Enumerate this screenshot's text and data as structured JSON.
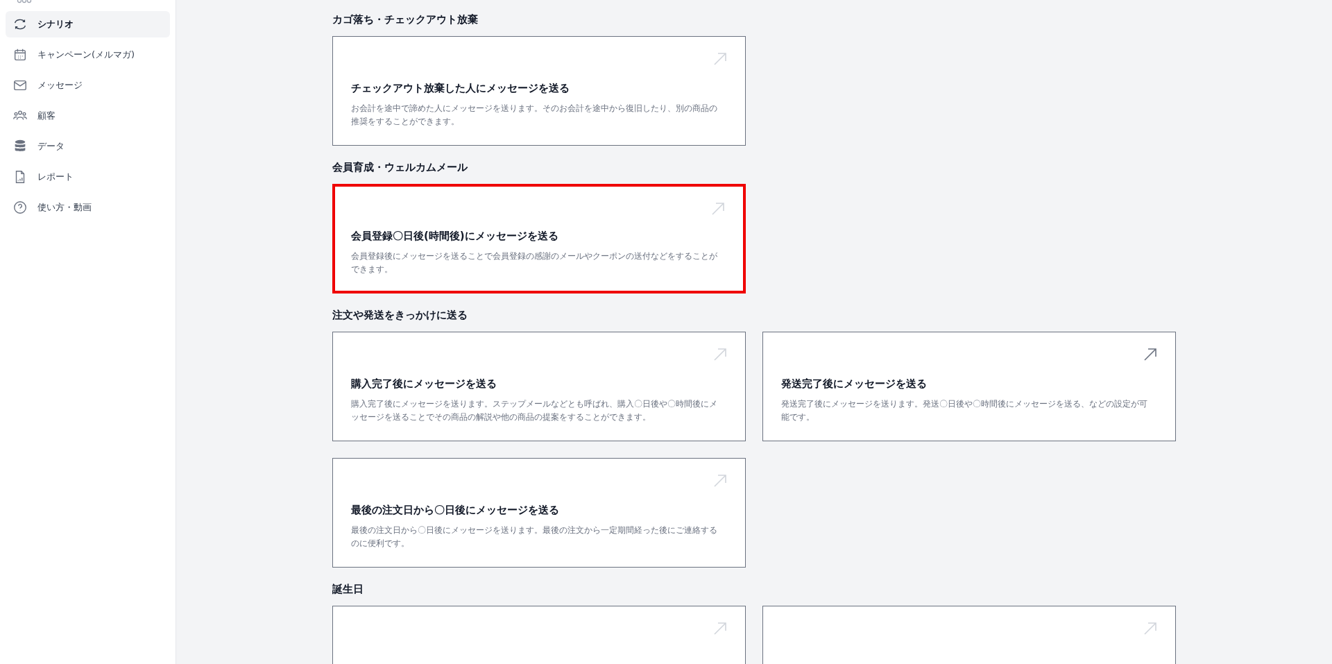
{
  "sidebar": {
    "items": [
      {
        "kind": "refresh",
        "label": "シナリオ",
        "selected": true
      },
      {
        "kind": "calendar",
        "label": "キャンペーン(メルマガ)",
        "selected": false
      },
      {
        "kind": "mail",
        "label": "メッセージ",
        "selected": false
      },
      {
        "kind": "users",
        "label": "顧客",
        "selected": false
      },
      {
        "kind": "database",
        "label": "データ",
        "selected": false
      },
      {
        "kind": "report",
        "label": "レポート",
        "selected": false
      },
      {
        "kind": "help",
        "label": "使い方・動画",
        "selected": false
      }
    ]
  },
  "sections": [
    {
      "heading": "カゴ落ち・チェックアウト放棄",
      "cards": [
        {
          "title": "チェックアウト放棄した人にメッセージを送る",
          "description": "お会計を途中で諦めた人にメッセージを送ります。そのお会計を途中から復旧したり、別の商品の推奨をすることができます。",
          "highlighted": false,
          "hovered": false
        }
      ]
    },
    {
      "heading": "会員育成・ウェルカムメール",
      "cards": [
        {
          "title": "会員登録〇日後(時間後)にメッセージを送る",
          "description": "会員登録後にメッセージを送ることで会員登録の感謝のメールやクーポンの送付などをすることができます。",
          "highlighted": true,
          "hovered": false
        }
      ]
    },
    {
      "heading": "注文や発送をきっかけに送る",
      "cards": [
        {
          "title": "購入完了後にメッセージを送る",
          "description": "購入完了後にメッセージを送ります。ステップメールなどとも呼ばれ、購入〇日後や〇時間後にメッセージを送ることでその商品の解説や他の商品の提案をすることができます。",
          "highlighted": false,
          "hovered": false
        },
        {
          "title": "発送完了後にメッセージを送る",
          "description": "発送完了後にメッセージを送ります。発送〇日後や〇時間後にメッセージを送る、などの設定が可能です。",
          "highlighted": false,
          "hovered": true
        },
        {
          "title": "最後の注文日から〇日後にメッセージを送る",
          "description": "最後の注文日から〇日後にメッセージを送ります。最後の注文から一定期間経った後にご連絡するのに便利です。",
          "highlighted": false,
          "hovered": false
        }
      ]
    },
    {
      "heading": "誕生日",
      "cards": [
        {
          "highlighted": false,
          "hovered": false
        },
        {
          "highlighted": false,
          "hovered": false
        }
      ]
    }
  ]
}
